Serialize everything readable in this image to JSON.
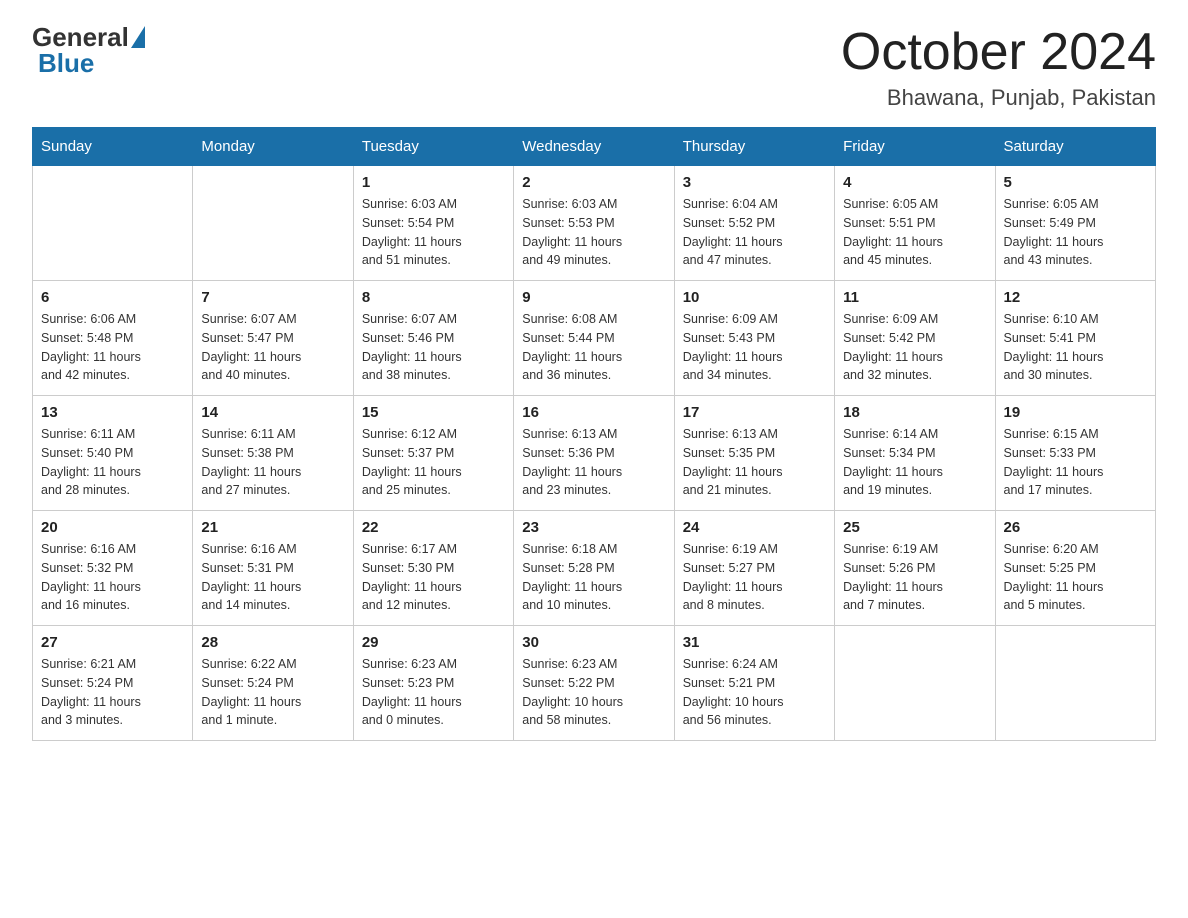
{
  "logo": {
    "general": "General",
    "blue": "Blue"
  },
  "title": "October 2024",
  "subtitle": "Bhawana, Punjab, Pakistan",
  "weekdays": [
    "Sunday",
    "Monday",
    "Tuesday",
    "Wednesday",
    "Thursday",
    "Friday",
    "Saturday"
  ],
  "weeks": [
    [
      {
        "day": "",
        "info": ""
      },
      {
        "day": "",
        "info": ""
      },
      {
        "day": "1",
        "info": "Sunrise: 6:03 AM\nSunset: 5:54 PM\nDaylight: 11 hours\nand 51 minutes."
      },
      {
        "day": "2",
        "info": "Sunrise: 6:03 AM\nSunset: 5:53 PM\nDaylight: 11 hours\nand 49 minutes."
      },
      {
        "day": "3",
        "info": "Sunrise: 6:04 AM\nSunset: 5:52 PM\nDaylight: 11 hours\nand 47 minutes."
      },
      {
        "day": "4",
        "info": "Sunrise: 6:05 AM\nSunset: 5:51 PM\nDaylight: 11 hours\nand 45 minutes."
      },
      {
        "day": "5",
        "info": "Sunrise: 6:05 AM\nSunset: 5:49 PM\nDaylight: 11 hours\nand 43 minutes."
      }
    ],
    [
      {
        "day": "6",
        "info": "Sunrise: 6:06 AM\nSunset: 5:48 PM\nDaylight: 11 hours\nand 42 minutes."
      },
      {
        "day": "7",
        "info": "Sunrise: 6:07 AM\nSunset: 5:47 PM\nDaylight: 11 hours\nand 40 minutes."
      },
      {
        "day": "8",
        "info": "Sunrise: 6:07 AM\nSunset: 5:46 PM\nDaylight: 11 hours\nand 38 minutes."
      },
      {
        "day": "9",
        "info": "Sunrise: 6:08 AM\nSunset: 5:44 PM\nDaylight: 11 hours\nand 36 minutes."
      },
      {
        "day": "10",
        "info": "Sunrise: 6:09 AM\nSunset: 5:43 PM\nDaylight: 11 hours\nand 34 minutes."
      },
      {
        "day": "11",
        "info": "Sunrise: 6:09 AM\nSunset: 5:42 PM\nDaylight: 11 hours\nand 32 minutes."
      },
      {
        "day": "12",
        "info": "Sunrise: 6:10 AM\nSunset: 5:41 PM\nDaylight: 11 hours\nand 30 minutes."
      }
    ],
    [
      {
        "day": "13",
        "info": "Sunrise: 6:11 AM\nSunset: 5:40 PM\nDaylight: 11 hours\nand 28 minutes."
      },
      {
        "day": "14",
        "info": "Sunrise: 6:11 AM\nSunset: 5:38 PM\nDaylight: 11 hours\nand 27 minutes."
      },
      {
        "day": "15",
        "info": "Sunrise: 6:12 AM\nSunset: 5:37 PM\nDaylight: 11 hours\nand 25 minutes."
      },
      {
        "day": "16",
        "info": "Sunrise: 6:13 AM\nSunset: 5:36 PM\nDaylight: 11 hours\nand 23 minutes."
      },
      {
        "day": "17",
        "info": "Sunrise: 6:13 AM\nSunset: 5:35 PM\nDaylight: 11 hours\nand 21 minutes."
      },
      {
        "day": "18",
        "info": "Sunrise: 6:14 AM\nSunset: 5:34 PM\nDaylight: 11 hours\nand 19 minutes."
      },
      {
        "day": "19",
        "info": "Sunrise: 6:15 AM\nSunset: 5:33 PM\nDaylight: 11 hours\nand 17 minutes."
      }
    ],
    [
      {
        "day": "20",
        "info": "Sunrise: 6:16 AM\nSunset: 5:32 PM\nDaylight: 11 hours\nand 16 minutes."
      },
      {
        "day": "21",
        "info": "Sunrise: 6:16 AM\nSunset: 5:31 PM\nDaylight: 11 hours\nand 14 minutes."
      },
      {
        "day": "22",
        "info": "Sunrise: 6:17 AM\nSunset: 5:30 PM\nDaylight: 11 hours\nand 12 minutes."
      },
      {
        "day": "23",
        "info": "Sunrise: 6:18 AM\nSunset: 5:28 PM\nDaylight: 11 hours\nand 10 minutes."
      },
      {
        "day": "24",
        "info": "Sunrise: 6:19 AM\nSunset: 5:27 PM\nDaylight: 11 hours\nand 8 minutes."
      },
      {
        "day": "25",
        "info": "Sunrise: 6:19 AM\nSunset: 5:26 PM\nDaylight: 11 hours\nand 7 minutes."
      },
      {
        "day": "26",
        "info": "Sunrise: 6:20 AM\nSunset: 5:25 PM\nDaylight: 11 hours\nand 5 minutes."
      }
    ],
    [
      {
        "day": "27",
        "info": "Sunrise: 6:21 AM\nSunset: 5:24 PM\nDaylight: 11 hours\nand 3 minutes."
      },
      {
        "day": "28",
        "info": "Sunrise: 6:22 AM\nSunset: 5:24 PM\nDaylight: 11 hours\nand 1 minute."
      },
      {
        "day": "29",
        "info": "Sunrise: 6:23 AM\nSunset: 5:23 PM\nDaylight: 11 hours\nand 0 minutes."
      },
      {
        "day": "30",
        "info": "Sunrise: 6:23 AM\nSunset: 5:22 PM\nDaylight: 10 hours\nand 58 minutes."
      },
      {
        "day": "31",
        "info": "Sunrise: 6:24 AM\nSunset: 5:21 PM\nDaylight: 10 hours\nand 56 minutes."
      },
      {
        "day": "",
        "info": ""
      },
      {
        "day": "",
        "info": ""
      }
    ]
  ]
}
